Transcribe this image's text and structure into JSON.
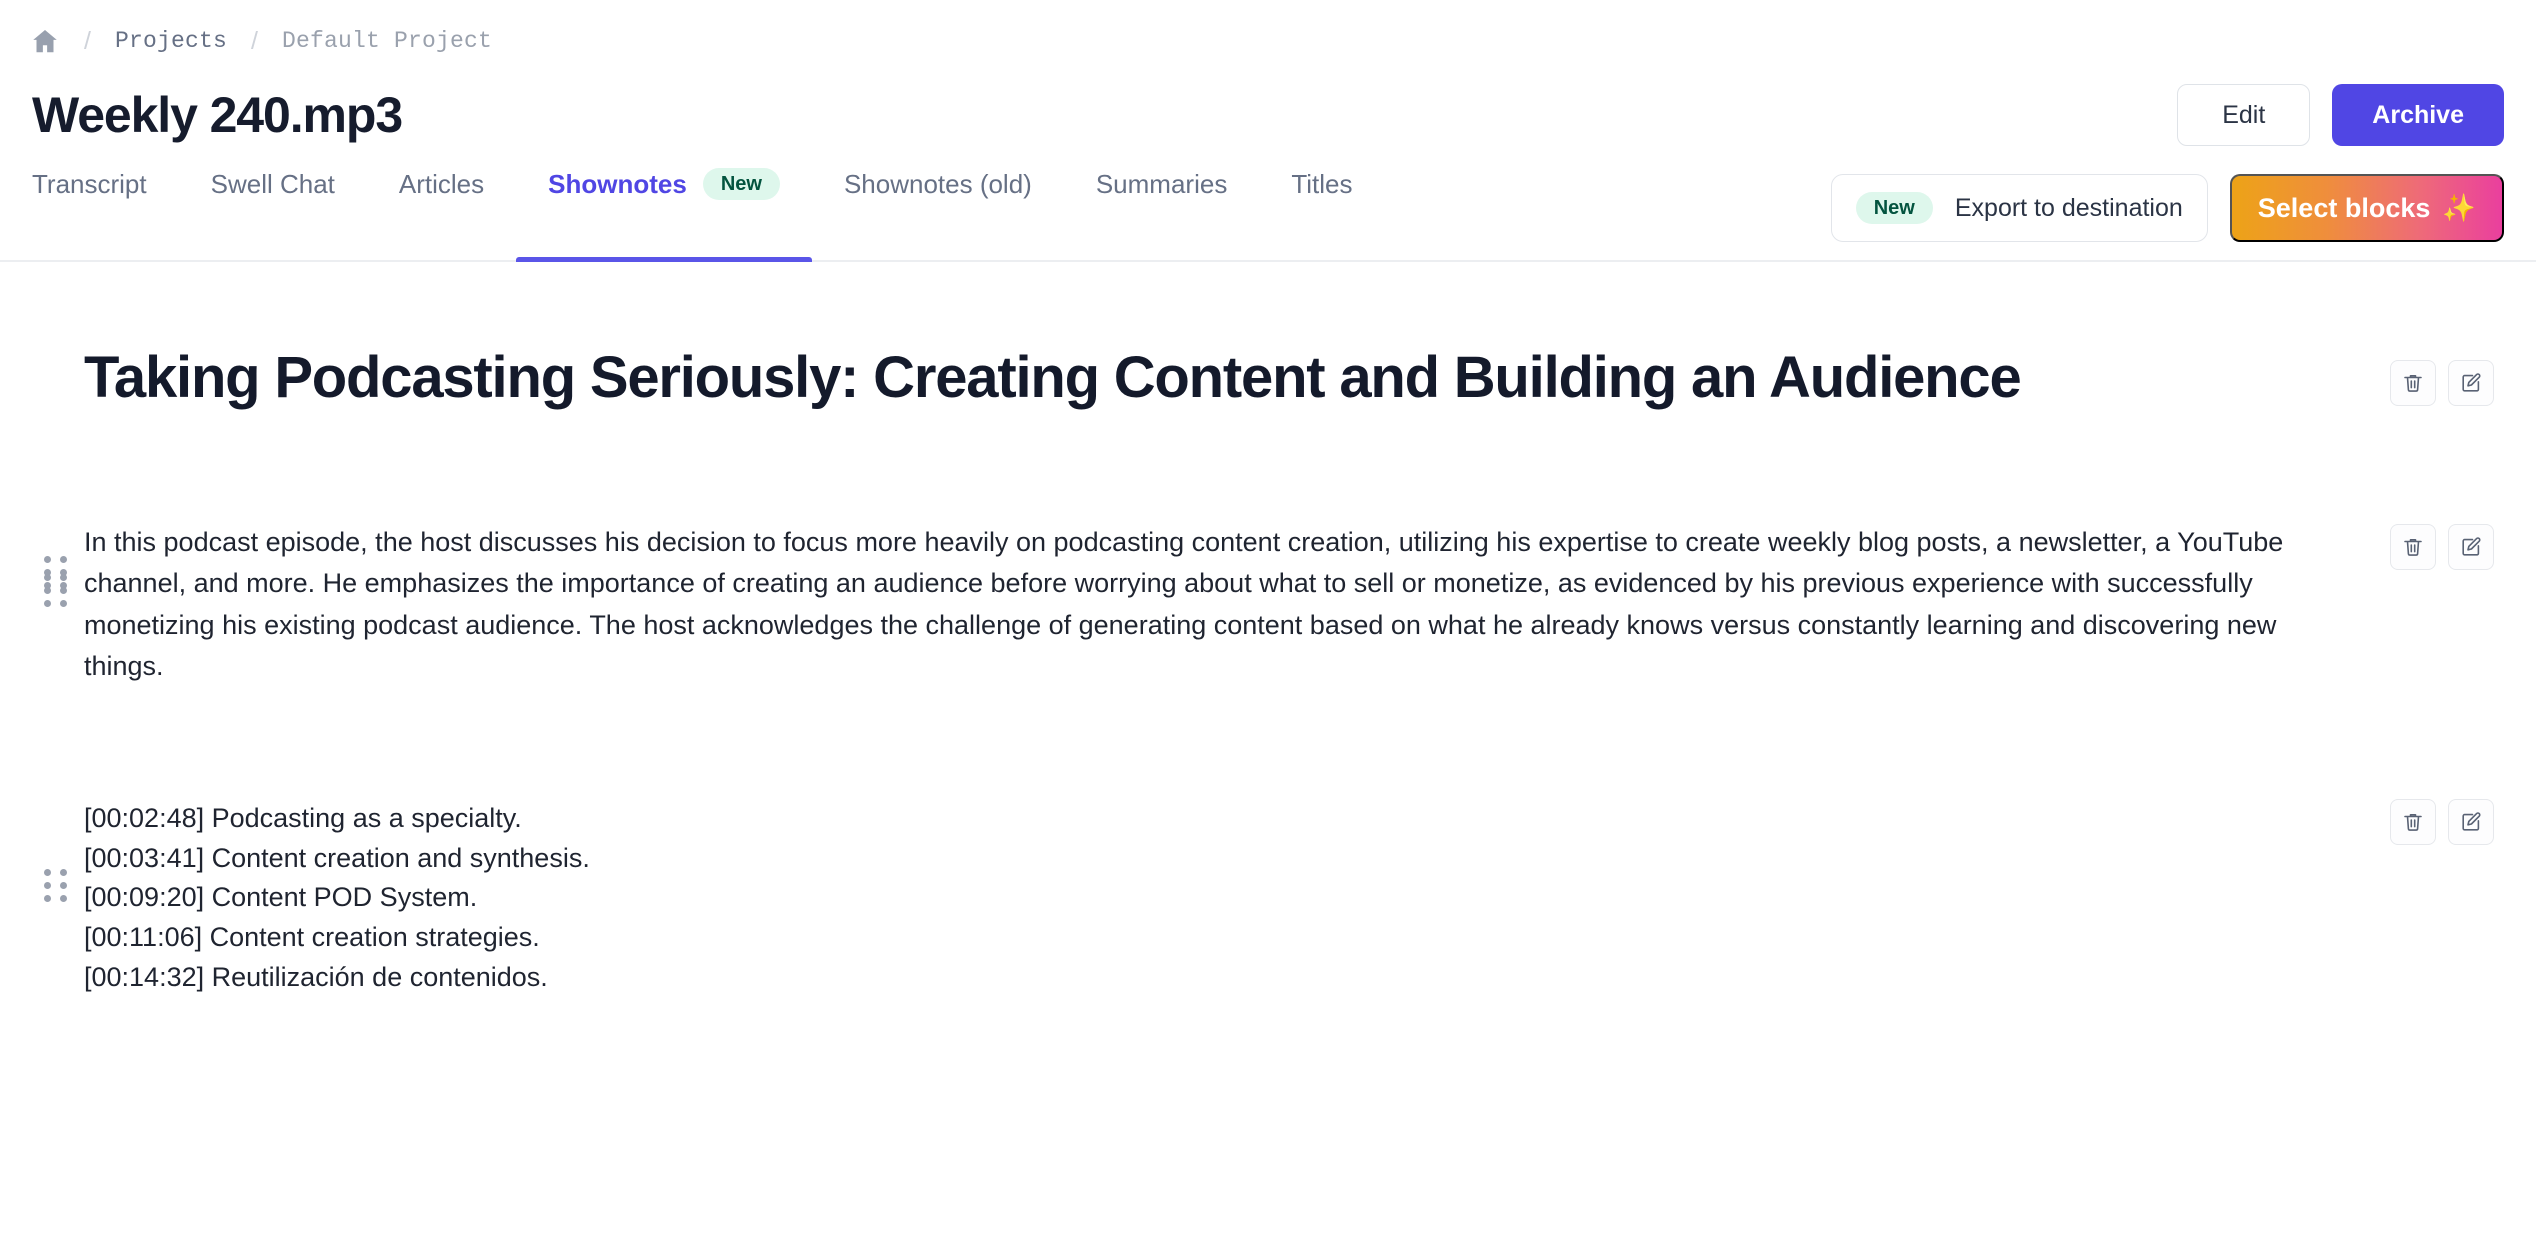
{
  "breadcrumb": {
    "home_icon": "home-icon",
    "separator": "/",
    "items": [
      {
        "label": "Projects"
      },
      {
        "label": "Default Project"
      }
    ]
  },
  "header": {
    "title": "Weekly 240.mp3",
    "edit_label": "Edit",
    "archive_label": "Archive",
    "archive_color": "#5046e4"
  },
  "tabs": [
    {
      "label": "Transcript",
      "active": false,
      "badge": ""
    },
    {
      "label": "Swell Chat",
      "active": false,
      "badge": ""
    },
    {
      "label": "Articles",
      "active": false,
      "badge": ""
    },
    {
      "label": "Shownotes",
      "active": true,
      "badge": "New"
    },
    {
      "label": "Shownotes (old)",
      "active": false,
      "badge": ""
    },
    {
      "label": "Summaries",
      "active": false,
      "badge": ""
    },
    {
      "label": "Titles",
      "active": false,
      "badge": ""
    }
  ],
  "tabbar_actions": {
    "export_badge": "New",
    "export_label": "Export to destination",
    "select_blocks_label": "Select blocks",
    "sparkle_icon": "✨",
    "gradient_from": "#eda317",
    "gradient_to": "#ea3f9e",
    "badge_bg": "#def7ec",
    "badge_text_color": "#03543f"
  },
  "blocks": [
    {
      "type": "heading",
      "text": "Taking Podcasting Seriously: Creating Content and Building an Audience",
      "delete_icon": "trash-icon",
      "edit_icon": "edit-square-icon"
    },
    {
      "type": "paragraph",
      "text": "In this podcast episode, the host discusses his decision to focus more heavily on podcasting content creation, utilizing his expertise to create weekly blog posts, a newsletter, a YouTube channel, and more. He emphasizes the importance of creating an audience before worrying about what to sell or monetize, as evidenced by his previous experience with successfully monetizing his existing podcast audience. The host acknowledges the challenge of generating content based on what he already knows versus constantly learning and discovering new things.",
      "delete_icon": "trash-icon",
      "edit_icon": "edit-square-icon"
    },
    {
      "type": "list",
      "lines": [
        "[00:02:48] Podcasting as a specialty.",
        "[00:03:41] Content creation and synthesis.",
        "[00:09:20] Content POD System.",
        "[00:11:06] Content creation strategies.",
        "[00:14:32] Reutilización de contenidos."
      ],
      "delete_icon": "trash-icon",
      "edit_icon": "edit-square-icon"
    }
  ]
}
